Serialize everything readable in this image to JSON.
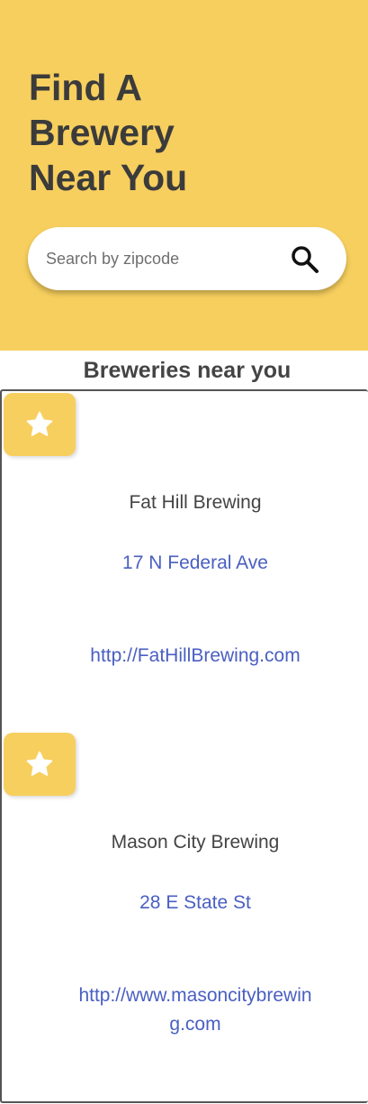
{
  "header": {
    "title": "Find A Brewery Near You",
    "background_color": "#f7cf5e"
  },
  "search": {
    "placeholder": "Search by zipcode",
    "value": "",
    "button_icon": "search-icon"
  },
  "results": {
    "heading": "Breweries near you",
    "items": [
      {
        "favorite_icon": "star-icon",
        "name": "Fat Hill Brewing",
        "address": "17 N Federal Ave",
        "url": "http://FatHillBrewing.com"
      },
      {
        "favorite_icon": "star-icon",
        "name": "Mason City Brewing",
        "address": "28 E State St",
        "url": "http://www.masoncitybrewing.com"
      }
    ]
  },
  "colors": {
    "accent": "#f7cf5e",
    "link": "#4a5fc1",
    "text": "#3b3b3b"
  }
}
